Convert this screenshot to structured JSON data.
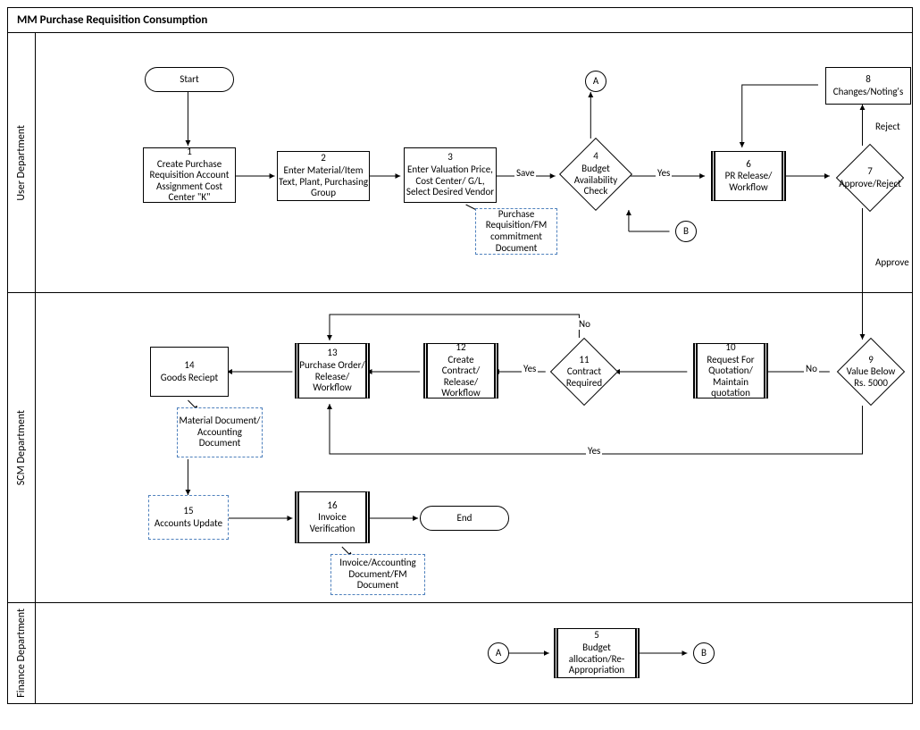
{
  "title": "MM Purchase Requisition Consumption",
  "lanes": {
    "user": "User Department",
    "scm": "SCM Department",
    "fin": "Finance Department"
  },
  "start": "Start",
  "end": "End",
  "conn": {
    "A": "A",
    "B": "B"
  },
  "labels": {
    "save": "Save",
    "yes": "Yes",
    "no": "No",
    "approve": "Approve",
    "reject": "Reject"
  },
  "n1": {
    "id": "1",
    "t": "Create Purchase Requisition Account Assignment Cost Center \"K\""
  },
  "n2": {
    "id": "2",
    "t": "Enter Material/Item Text, Plant, Purchasing Group"
  },
  "n3": {
    "id": "3",
    "t": "Enter Valuation Price, Cost Center/ G/L, Select Desired Vendor"
  },
  "n4": {
    "id": "4",
    "t": "Budget Availability Check"
  },
  "n5": {
    "id": "5",
    "t": "Budget allocation/Re- Appropriation"
  },
  "n6": {
    "id": "6",
    "t": "PR Release/ Workflow"
  },
  "n7": {
    "id": "7",
    "t": "Approve/Reject"
  },
  "n8": {
    "id": "8",
    "t": "Changes/Noting's"
  },
  "n9": {
    "id": "9",
    "t": "Value Below Rs. 5000"
  },
  "n10": {
    "id": "10",
    "t": "Request For Quotation/ Maintain quotation"
  },
  "n11": {
    "id": "11",
    "t": "Contract Required"
  },
  "n12": {
    "id": "12",
    "t": "Create Contract/ Release/ Workflow"
  },
  "n13": {
    "id": "13",
    "t": "Purchase Order/ Release/ Workflow"
  },
  "n14": {
    "id": "14",
    "t": "Goods Reciept"
  },
  "n15": {
    "id": "15",
    "t": "Accounts Update"
  },
  "n16": {
    "id": "16",
    "t": "Invoice Verification"
  },
  "d3": "Purchase Requisition/FM commitment Document",
  "d14": "Material Document/ Accounting Document",
  "d16": "Invoice/Accounting Document/FM Document"
}
